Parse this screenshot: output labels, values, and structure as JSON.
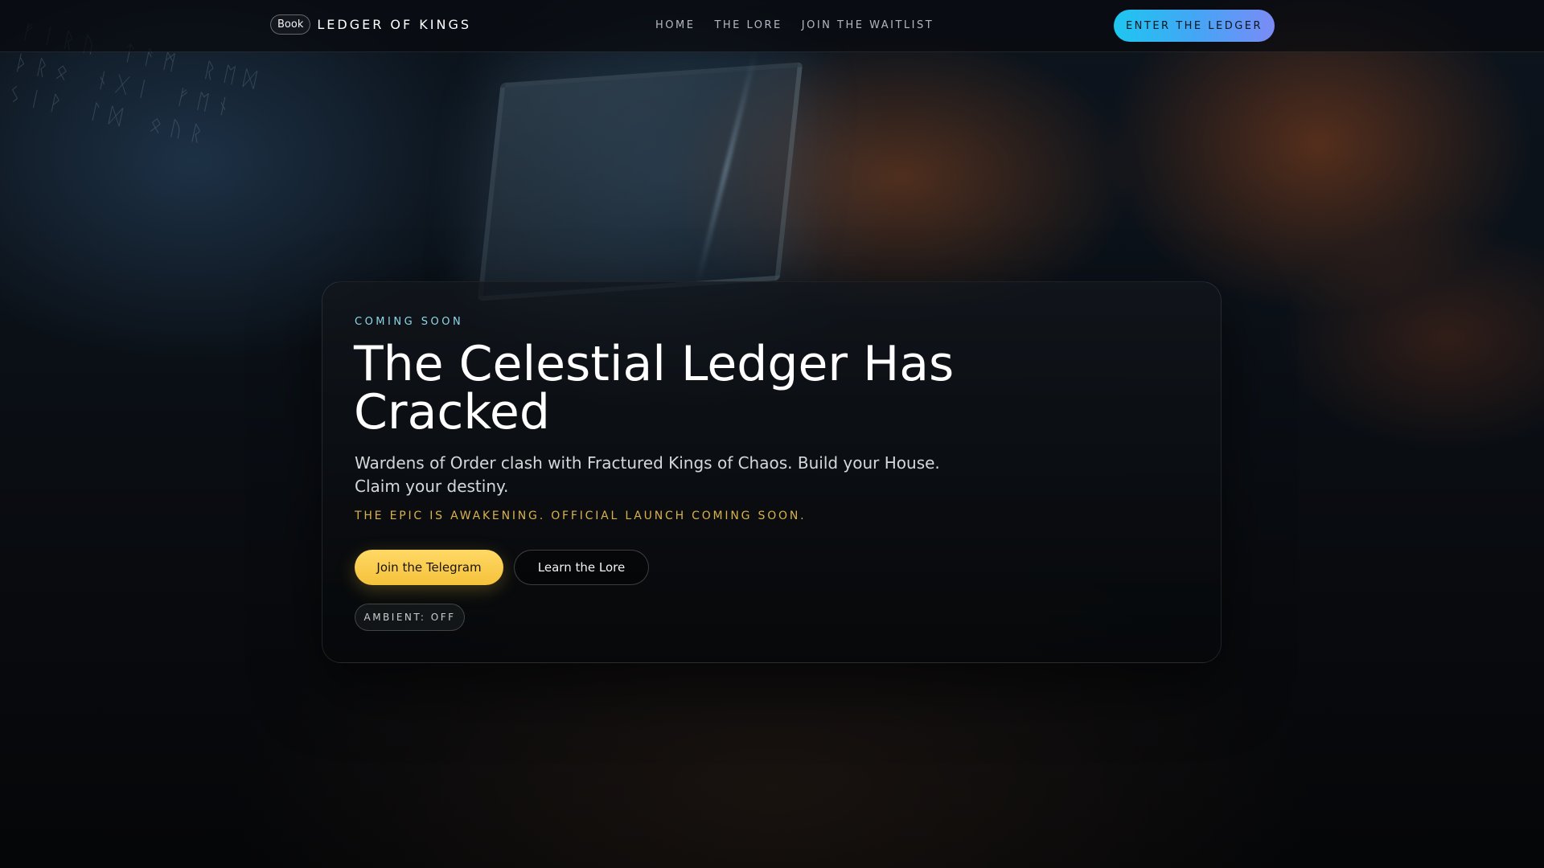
{
  "header": {
    "brand_badge": "Book",
    "brand_name": "LEDGER OF KINGS",
    "nav": [
      {
        "label": "HOME"
      },
      {
        "label": "THE LORE"
      },
      {
        "label": "JOIN THE WAITLIST"
      }
    ],
    "cta_label": "ENTER THE LEDGER"
  },
  "hero": {
    "eyebrow": "COMING SOON",
    "title": "The Celestial Ledger Has Cracked",
    "subtitle": "Wardens of Order clash with Fractured Kings of Chaos. Build your House. Claim your destiny.",
    "announcement": "THE EPIC IS AWAKENING. OFFICIAL LAUNCH COMING SOON.",
    "primary_button": "Join the Telegram",
    "secondary_button": "Learn the Lore",
    "ambient_toggle": "AMBIENT: OFF"
  },
  "colors": {
    "accent_gold": "#f5c23b",
    "accent_cyan": "#1ec6f0",
    "accent_violet": "#7b8bf6",
    "eyebrow_teal": "#8fd6e8"
  }
}
